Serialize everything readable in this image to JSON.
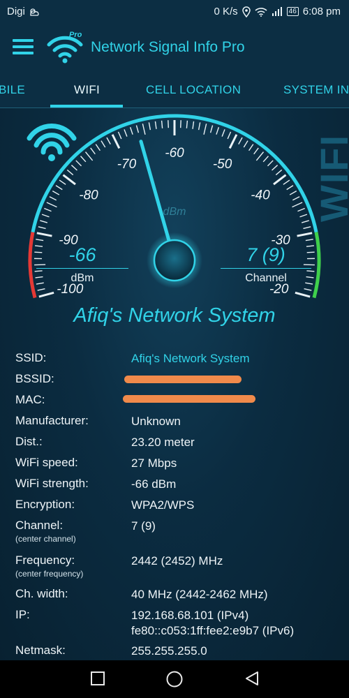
{
  "status_bar": {
    "carrier": "Digi",
    "weather_icon": "cloud-icon",
    "net_speed": "0 K/s",
    "battery": "46",
    "time": "6:08 pm"
  },
  "app_bar": {
    "title": "Network Signal Info Pro",
    "logo_badge": "Pro"
  },
  "tabs": [
    {
      "label": "MOBILE"
    },
    {
      "label": "WIFI"
    },
    {
      "label": "CELL LOCATION"
    },
    {
      "label": "SYSTEM INFO"
    }
  ],
  "active_tab": "WIFI",
  "gauge": {
    "scale_labels": [
      "-100",
      "-90",
      "-80",
      "-70",
      "-60",
      "-50",
      "-40",
      "-30",
      "-20"
    ],
    "unit_label": "dBm",
    "vertical_label": "WIFI",
    "needle_value_dbm": -66,
    "range": [
      -100,
      -20
    ],
    "colors": {
      "accent": "#31d3e8",
      "low": "#e53935",
      "high": "#3fd04c"
    }
  },
  "readings": {
    "signal": {
      "value": "-66",
      "unit": "dBm"
    },
    "channel": {
      "value": "7 (9)",
      "unit": "Channel"
    }
  },
  "network_name": "Afiq's Network System",
  "info": {
    "ssid": {
      "label": "SSID:",
      "value": "Afiq's Network System"
    },
    "bssid": {
      "label": "BSSID:",
      "value": ""
    },
    "mac": {
      "label": "MAC:",
      "value": ""
    },
    "manufacturer": {
      "label": "Manufacturer:",
      "value": "Unknown"
    },
    "distance": {
      "label": "Dist.:",
      "value": "23.20 meter"
    },
    "speed": {
      "label": "WiFi speed:",
      "value": "27 Mbps"
    },
    "strength": {
      "label": "WiFi strength:",
      "value": "-66 dBm"
    },
    "encryption": {
      "label": "Encryption:",
      "value": "WPA2/WPS"
    },
    "channel": {
      "label": "Channel:",
      "note": "(center channel)",
      "value": "7 (9)"
    },
    "frequency": {
      "label": "Frequency:",
      "note": "(center frequency)",
      "value": "2442 (2452) MHz"
    },
    "width": {
      "label": "Ch. width:",
      "value": "40 MHz (2442-2462 MHz)"
    },
    "ip": {
      "label": "IP:",
      "value": "192.168.68.101 (IPv4)\nfe80::c053:1ff:fee2:e9b7 (IPv6)"
    },
    "netmask": {
      "label": "Netmask:",
      "value": "255.255.255.0"
    }
  },
  "nav_icons": [
    "recents-square-icon",
    "home-circle-icon",
    "back-triangle-icon"
  ]
}
